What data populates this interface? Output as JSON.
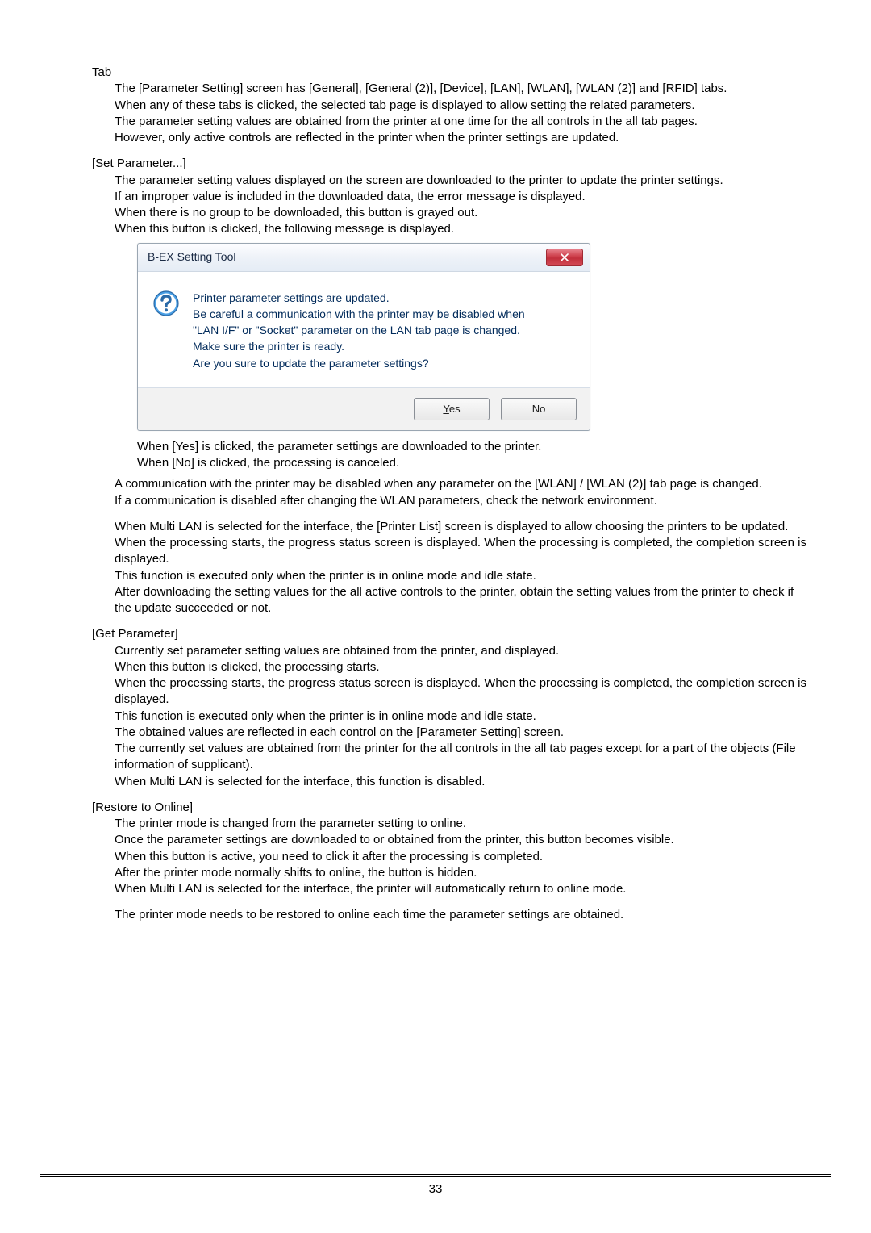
{
  "tab": {
    "heading": "Tab",
    "p1": "The [Parameter Setting] screen has [General], [General (2)], [Device], [LAN], [WLAN], [WLAN (2)] and [RFID] tabs.",
    "p2": "When any of these tabs is clicked, the selected tab page is displayed to allow setting the related parameters.",
    "p3": "The parameter setting values are obtained from the printer at one time for the all controls in the all tab pages.",
    "p4": "However, only active controls are reflected in the printer when the printer settings are updated."
  },
  "setparam": {
    "heading": "[Set Parameter...]",
    "p1": "The parameter setting values displayed on the screen are downloaded to the printer to update the printer settings.",
    "p2": "If an improper value is included in the downloaded data, the error message is displayed.",
    "p3": "When there is no group to be downloaded, this button is grayed out.",
    "p4": "When this button is clicked, the following message is displayed.",
    "dialog": {
      "title": "B-EX Setting Tool",
      "m1": "Printer parameter settings are updated.",
      "m2": "Be careful a communication with the printer may be disabled when",
      "m3": "\"LAN I/F\" or \"Socket\" parameter on the LAN tab page is changed.",
      "m4": "Make sure the printer is ready.",
      "m5": "Are you sure to update the parameter settings?",
      "yes_m": "Y",
      "yes_rest": "es",
      "no": "No"
    },
    "afterdlg": {
      "p1": "When [Yes] is clicked, the parameter settings are downloaded to the printer.",
      "p2": "When [No] is clicked, the processing is canceled."
    },
    "p5": "A communication with the printer may be disabled when any parameter on the [WLAN] / [WLAN (2)] tab page is changed.",
    "p6": "If a communication is disabled after changing the WLAN parameters, check the network environment.",
    "p7": "When Multi LAN is selected for the interface, the [Printer List] screen is displayed to allow choosing the printers to be updated.",
    "p8": "When the processing starts, the progress status screen is displayed.  When the processing is completed, the completion screen is displayed.",
    "p9": "This function is executed only when the printer is in online mode and idle state.",
    "p10": "After downloading the setting values for the all active controls to the printer, obtain the setting values from the printer to check if the update succeeded or not."
  },
  "getparam": {
    "heading": "[Get Parameter]",
    "p1": "Currently set parameter setting values are obtained from the printer, and displayed.",
    "p2": "When this button is clicked, the processing starts.",
    "p3": "When the processing starts, the progress status screen is displayed.  When the processing is completed, the completion screen is displayed.",
    "p4": "This function is executed only when the printer is in online mode and idle state.",
    "p5": "The obtained values are reflected in each control on the [Parameter Setting] screen.",
    "p6": "The currently set values are obtained from the printer for the all controls in the all tab pages except for a part of the objects (File information of supplicant).",
    "p7": "When Multi LAN is selected for the interface, this function is disabled."
  },
  "restore": {
    "heading": "[Restore to Online]",
    "p1": "The printer mode is changed from the parameter setting to online.",
    "p2": "Once the parameter settings are downloaded to or obtained from the printer, this button becomes visible.",
    "p3": "When this button is active, you need to click it after the processing is completed.",
    "p4": "After the printer mode normally shifts to online, the button is hidden.",
    "p5": "When Multi LAN is selected for the interface, the printer will automatically return to online mode.",
    "p6": "The printer mode needs to be restored to online each time the parameter settings are obtained."
  },
  "pageno": "33"
}
